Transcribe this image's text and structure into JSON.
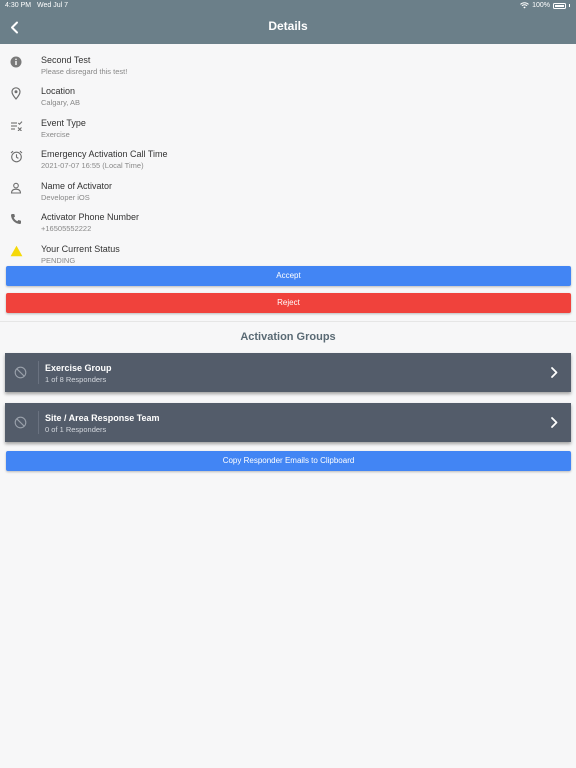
{
  "status_bar": {
    "time": "4:30 PM",
    "date": "Wed Jul 7",
    "battery": "100%"
  },
  "header": {
    "title": "Details",
    "back_icon": "chevron-left-icon"
  },
  "details": [
    {
      "icon": "info-icon",
      "label": "Second Test",
      "value": "Please disregard this test!"
    },
    {
      "icon": "location-pin-icon",
      "label": "Location",
      "value": "Calgary, AB"
    },
    {
      "icon": "event-type-icon",
      "label": "Event Type",
      "value": "Exercise"
    },
    {
      "icon": "alarm-clock-icon",
      "label": "Emergency Activation Call Time",
      "value": "2021-07-07 16:55 (Local Time)"
    },
    {
      "icon": "person-icon",
      "label": "Name of Activator",
      "value": "Developer iOS"
    },
    {
      "icon": "phone-icon",
      "label": "Activator Phone Number",
      "value": "+16505552222"
    },
    {
      "icon": "warning-icon",
      "label": "Your Current Status",
      "value": "PENDING"
    }
  ],
  "actions": {
    "accept_label": "Accept",
    "reject_label": "Reject"
  },
  "activation_groups": {
    "title": "Activation Groups",
    "groups": [
      {
        "name": "Exercise Group",
        "responders": "1 of 8 Responders"
      },
      {
        "name": "Site / Area Response Team",
        "responders": "0 of 1 Responders"
      }
    ],
    "copy_label": "Copy Responder Emails to Clipboard"
  },
  "colors": {
    "header": "#6b7f89",
    "accept": "#4285f4",
    "reject": "#f0423c",
    "group_card": "#535c6a",
    "warning": "#f5d90a"
  }
}
